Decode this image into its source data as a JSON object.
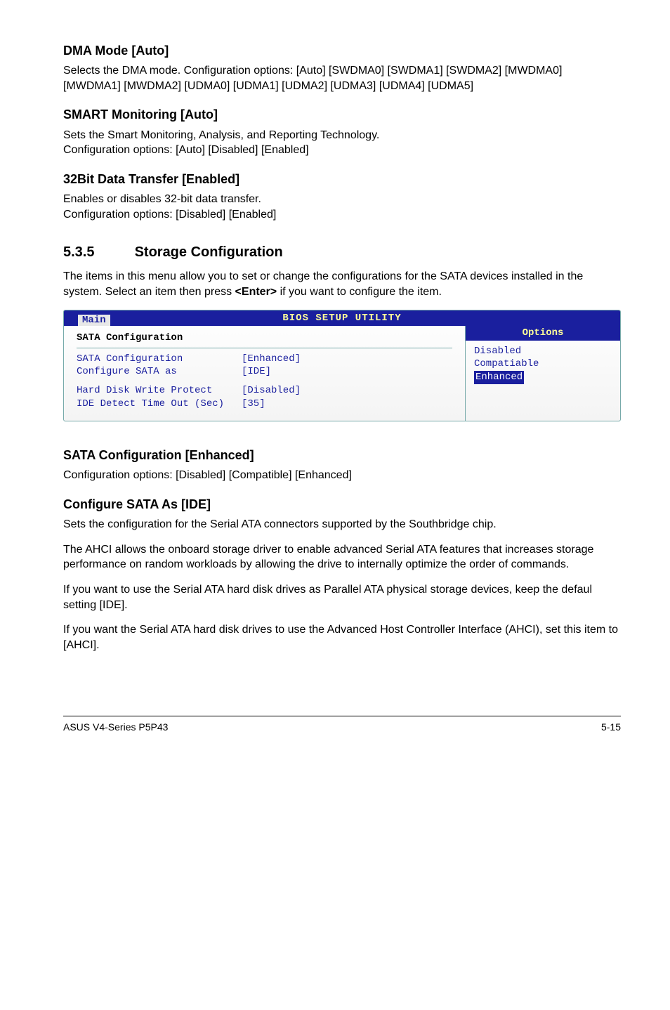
{
  "sec1": {
    "title": "DMA Mode [Auto]",
    "body": "Selects the DMA mode. Configuration options: [Auto] [SWDMA0] [SWDMA1] [SWDMA2] [MWDMA0] [MWDMA1] [MWDMA2] [UDMA0] [UDMA1] [UDMA2] [UDMA3] [UDMA4] [UDMA5]"
  },
  "sec2": {
    "title": "SMART Monitoring [Auto]",
    "body1": "Sets the Smart Monitoring, Analysis, and Reporting Technology.",
    "body2": "Configuration options: [Auto] [Disabled] [Enabled]"
  },
  "sec3": {
    "title": "32Bit Data Transfer [Enabled]",
    "body1": "Enables or disables 32-bit data transfer.",
    "body2": "Configuration options: [Disabled] [Enabled]"
  },
  "h2": {
    "num": "5.3.5",
    "title": "Storage Configuration"
  },
  "intro": {
    "part1": "The items in this menu allow you to set or change the configurations for the SATA devices installed in the system. Select an item then press ",
    "bold": "<Enter>",
    "part2": " if you want to configure the item."
  },
  "bios": {
    "utility_title": "BIOS SETUP UTILITY",
    "tab": "Main",
    "section_title": "SATA Configuration",
    "rows": [
      {
        "label": "SATA Configuration",
        "value": "[Enhanced]"
      },
      {
        "label": "Configure SATA as",
        "value": "[IDE]"
      }
    ],
    "rows2": [
      {
        "label": "Hard Disk Write Protect",
        "value": "[Disabled]"
      },
      {
        "label": "IDE Detect Time Out (Sec)",
        "value": "[35]"
      }
    ],
    "options_header": "Options",
    "options": [
      "Disabled",
      "Compatiable",
      "Enhanced"
    ],
    "selected_index": 2
  },
  "sec4": {
    "title": "SATA Configuration [Enhanced]",
    "body": "Configuration options: [Disabled] [Compatible] [Enhanced]"
  },
  "sec5": {
    "title": "Configure SATA As [IDE]",
    "p1": "Sets the configuration for the Serial ATA connectors supported by the Southbridge chip.",
    "p2": "The AHCI allows the onboard storage driver to enable advanced Serial ATA features that increases storage performance on random workloads by allowing the drive to internally optimize the order of commands.",
    "p3": "If you want to use the Serial ATA hard disk drives as Parallel ATA physical storage devices, keep the defaul setting [IDE].",
    "p4": "If you want the Serial ATA hard disk drives to use the Advanced Host Controller Interface (AHCI), set this item to [AHCI]."
  },
  "footer": {
    "left": "ASUS V4-Series P5P43",
    "right": "5-15"
  }
}
